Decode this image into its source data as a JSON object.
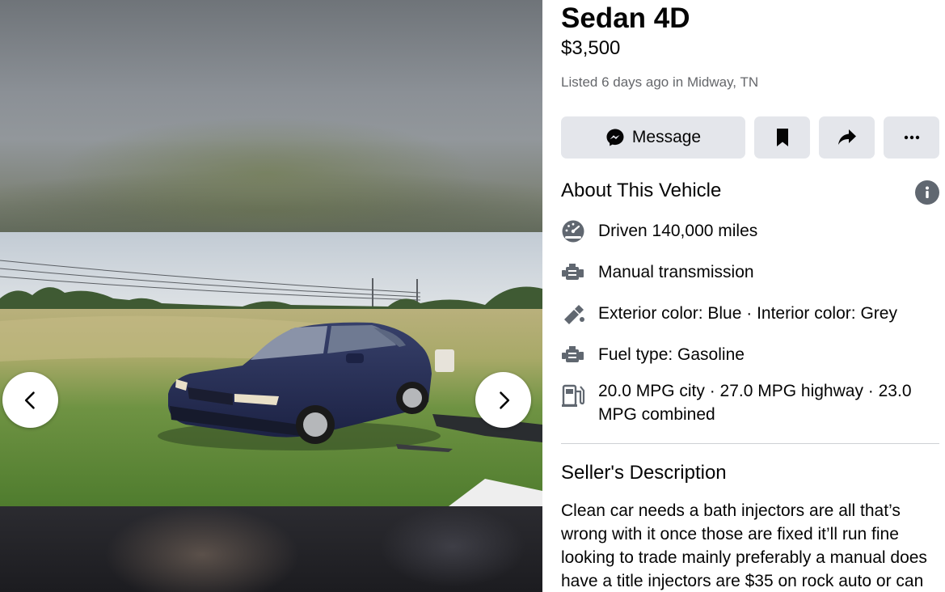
{
  "listing": {
    "title_visible_line": "Sedan 4D",
    "price": "$3,500",
    "listed": "Listed 6 days ago in Midway, TN"
  },
  "actions": {
    "message_label": "Message",
    "save_icon": "bookmark-icon",
    "share_icon": "share-arrow-icon",
    "more_icon": "more-dots-icon"
  },
  "about": {
    "title": "About This Vehicle",
    "specs": [
      {
        "icon": "speedometer-icon",
        "text": "Driven 140,000 miles"
      },
      {
        "icon": "engine-icon",
        "text": "Manual transmission"
      },
      {
        "icon": "paint-icon",
        "text": "Exterior color: Blue · Interior color: Grey"
      },
      {
        "icon": "engine-icon",
        "text": "Fuel type: Gasoline"
      },
      {
        "icon": "fuel-pump-icon",
        "text": "20.0 MPG city · 27.0 MPG highway · 23.0 MPG combined"
      }
    ]
  },
  "seller": {
    "title": "Seller's Description",
    "description": "Clean car needs a bath injectors are all that’s wrong with it once those are fixed it’ll run fine looking to trade mainly preferably a manual does have a title injectors are $35 on rock auto or can"
  },
  "viewer": {
    "prev_icon": "chevron-left-icon",
    "next_icon": "chevron-right-icon"
  },
  "colors": {
    "button_bg": "#e4e6eb",
    "secondary_text": "#65676b",
    "panel_bg": "#ffffff",
    "viewer_bg": "#242526"
  }
}
